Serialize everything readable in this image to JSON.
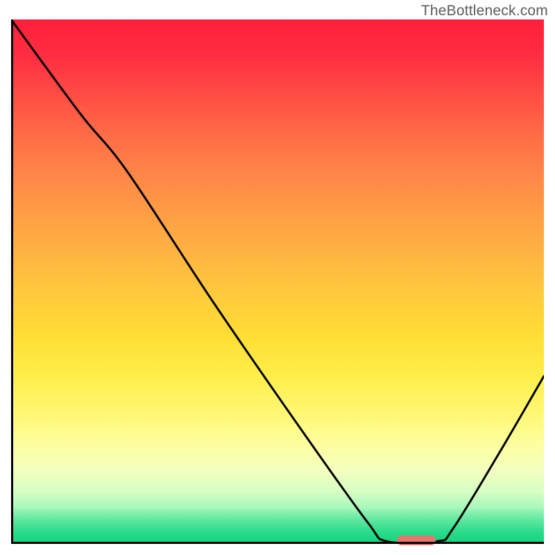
{
  "watermark": "TheBottleneck.com",
  "chart_data": {
    "type": "line",
    "title": "",
    "xlabel": "",
    "ylabel": "",
    "x_range_normalized": [
      0,
      1
    ],
    "y_range_normalized": [
      0,
      1
    ],
    "description": "Bottleneck curve: high mismatch at low x, descending sharply to a minimum near x≈0.75 then rising again. Background gradient encodes severity (red=high, green=low).",
    "series": [
      {
        "name": "bottleneck-curve",
        "points": [
          {
            "x": 0.0,
            "y": 1.0
          },
          {
            "x": 0.13,
            "y": 0.82
          },
          {
            "x": 0.218,
            "y": 0.71
          },
          {
            "x": 0.38,
            "y": 0.46
          },
          {
            "x": 0.55,
            "y": 0.21
          },
          {
            "x": 0.67,
            "y": 0.04
          },
          {
            "x": 0.705,
            "y": 0.005
          },
          {
            "x": 0.8,
            "y": 0.005
          },
          {
            "x": 0.83,
            "y": 0.03
          },
          {
            "x": 0.92,
            "y": 0.18
          },
          {
            "x": 1.0,
            "y": 0.32
          }
        ]
      }
    ],
    "optimum_marker": {
      "x_center": 0.76,
      "y": 0.0,
      "color": "#e7746f"
    },
    "gradient_stops": [
      {
        "pos": 0.0,
        "color": "#ff1f3a"
      },
      {
        "pos": 0.5,
        "color": "#ffc93d"
      },
      {
        "pos": 0.82,
        "color": "#fcffa6"
      },
      {
        "pos": 1.0,
        "color": "#15d47f"
      }
    ]
  }
}
